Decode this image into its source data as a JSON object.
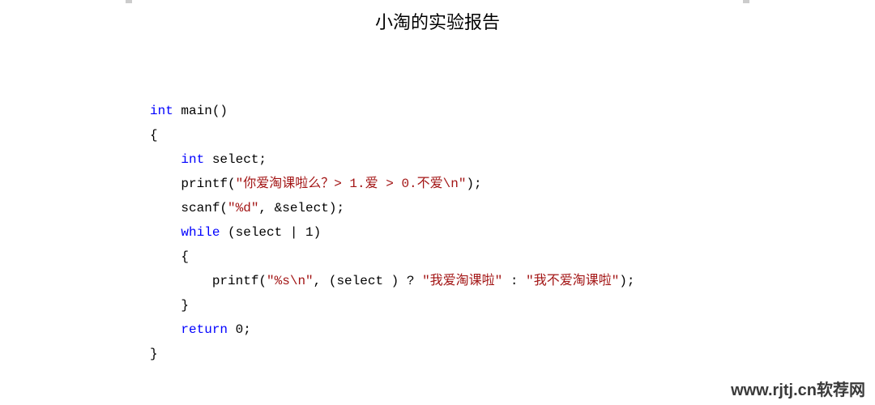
{
  "title": "小淘的实验报告",
  "code": {
    "kw_int1": "int",
    "main_decl": " main()",
    "brace_open1": "{",
    "indent1": "    ",
    "kw_int2": "int",
    "select_decl": " select;",
    "printf1_pre": "    printf(",
    "printf1_str": "\"你爱淘课啦么？> 1.爱 > 0.不爱\\n\"",
    "printf1_post": ");",
    "scanf_pre": "    scanf(",
    "scanf_str": "\"%d\"",
    "scanf_post": ", &select);",
    "while_pre": "    ",
    "kw_while": "while",
    "while_cond": " (select | 1)",
    "brace_open2": "    {",
    "printf2_pre": "        printf(",
    "printf2_str1": "\"%s\\n\"",
    "printf2_mid": ", (select ) ? ",
    "printf2_str2": "\"我爱淘课啦\"",
    "printf2_colon": " : ",
    "printf2_str3": "\"我不爱淘课啦\"",
    "printf2_post": ");",
    "brace_close2": "    }",
    "empty_line": "",
    "return_pre": "    ",
    "kw_return": "return",
    "return_val": " 0;",
    "brace_close1": "}"
  },
  "watermark": "www.rjtj.cn软荐网"
}
